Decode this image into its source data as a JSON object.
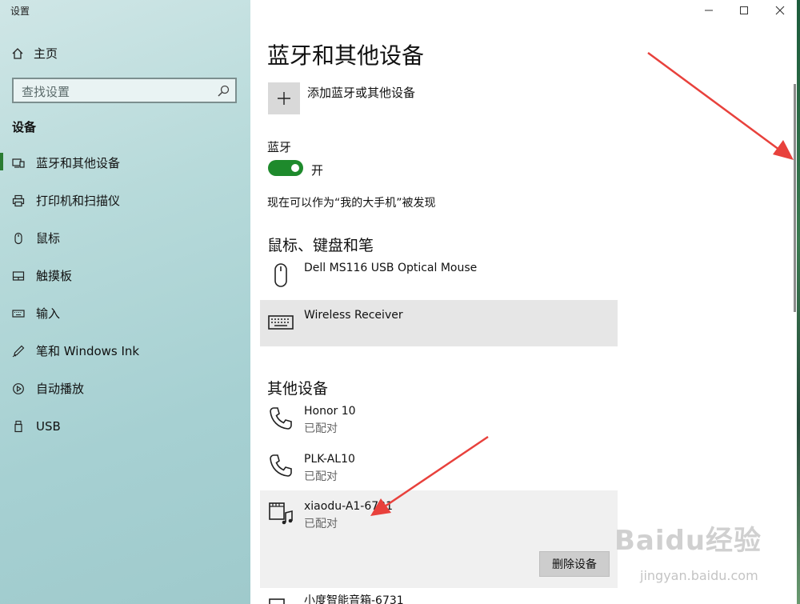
{
  "window": {
    "title": "设置"
  },
  "sidebar": {
    "home_label": "主页",
    "search_placeholder": "查找设置",
    "section_title": "设备",
    "items": [
      {
        "label": "蓝牙和其他设备",
        "icon": "bluetooth-devices-icon",
        "active": true
      },
      {
        "label": "打印机和扫描仪",
        "icon": "printer-icon"
      },
      {
        "label": "鼠标",
        "icon": "mouse-icon"
      },
      {
        "label": "触摸板",
        "icon": "touchpad-icon"
      },
      {
        "label": "输入",
        "icon": "keyboard-icon"
      },
      {
        "label": "笔和 Windows Ink",
        "icon": "pen-icon"
      },
      {
        "label": "自动播放",
        "icon": "autoplay-icon"
      },
      {
        "label": "USB",
        "icon": "usb-icon"
      }
    ]
  },
  "main": {
    "page_title": "蓝牙和其他设备",
    "add_device_label": "添加蓝牙或其他设备",
    "bluetooth_label": "蓝牙",
    "bluetooth_state": "开",
    "discoverable_text": "现在可以作为“我的大手机”被发现",
    "mouse_group_title": "鼠标、键盘和笔",
    "mouse_devices": [
      {
        "name": "Dell MS116 USB Optical Mouse",
        "icon": "mouse-icon"
      },
      {
        "name": "Wireless Receiver",
        "icon": "keyboard-icon"
      }
    ],
    "other_group_title": "其他设备",
    "other_devices": [
      {
        "name": "Honor 10",
        "status": "已配对",
        "icon": "phone-icon"
      },
      {
        "name": "PLK-AL10",
        "status": "已配对",
        "icon": "phone-icon"
      },
      {
        "name": "xiaodu-A1-6731",
        "status": "已配对",
        "icon": "audio-device-icon"
      },
      {
        "name": "小度智能音箱-6731",
        "icon": "audio-device-icon"
      }
    ],
    "remove_button": "删除设备"
  },
  "watermark": {
    "logo": "Baidu经验",
    "url": "jingyan.baidu.com"
  },
  "colors": {
    "accent": "#1e8a2c",
    "sidebar_bg": "#b7dada",
    "arrow": "#e8413c"
  }
}
